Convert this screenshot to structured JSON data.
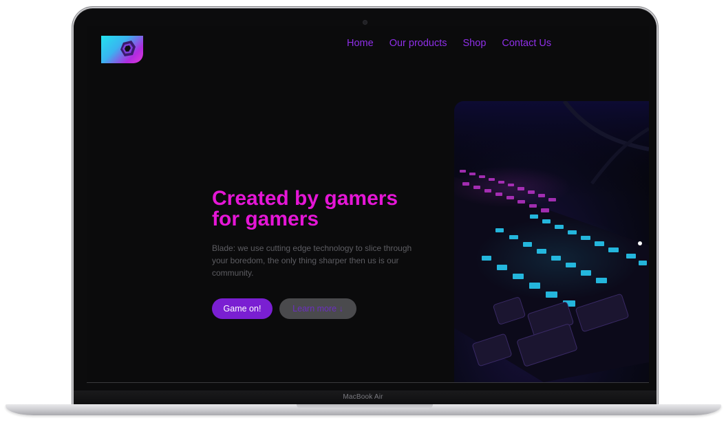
{
  "device": {
    "model_label": "MacBook Air"
  },
  "site": {
    "logo_icon": "blade-logo-icon",
    "nav": [
      {
        "label": "Home"
      },
      {
        "label": "Our products"
      },
      {
        "label": "Shop"
      },
      {
        "label": "Contact Us"
      }
    ],
    "hero": {
      "title_line1": "Created by gamers",
      "title_line2": "for gamers",
      "description": "Blade: we use cutting edge technology to slice through your boredom, the only thing sharper then us is our community.",
      "primary_button": "Game on!",
      "secondary_button": "Learn more ↓",
      "image": "backlit-gaming-keyboard-photo"
    },
    "colors": {
      "background": "#0b0b0c",
      "nav_link": "#8f2fe8",
      "title": "#e516d6",
      "primary_button": "#7a1fd2",
      "secondary_button": "#4a4a4d"
    }
  }
}
